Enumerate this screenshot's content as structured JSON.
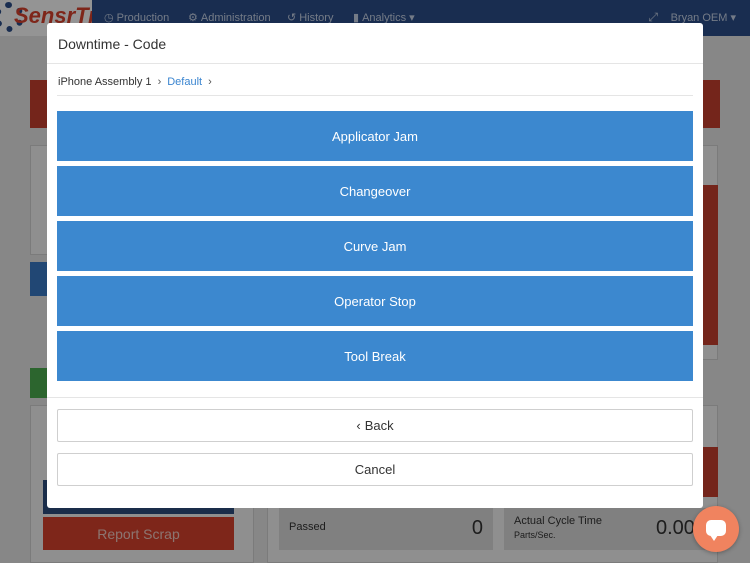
{
  "nav": {
    "logo_text": "SensrTrx",
    "items": [
      {
        "icon": "clock-icon",
        "glyph": "◷",
        "label": "Production"
      },
      {
        "icon": "gear-icon",
        "glyph": "⚙",
        "label": "Administration"
      },
      {
        "icon": "history-icon",
        "glyph": "↺",
        "label": "History"
      },
      {
        "icon": "bar-chart-icon",
        "glyph": "▮",
        "label": "Analytics ▾"
      }
    ],
    "expand_glyph": "⤢",
    "user": "Bryan OEM ▾"
  },
  "background": {
    "report_scrap": "Report Scrap",
    "passed_label": "Passed",
    "passed_value": "0",
    "cycle_label": "Actual Cycle Time",
    "cycle_unit": "Parts/Sec.",
    "cycle_value": "0.00"
  },
  "modal": {
    "title": "Downtime - Code",
    "breadcrumb": {
      "root": "iPhone Assembly 1",
      "current": "Default",
      "sep": "›"
    },
    "codes": [
      {
        "label": "Applicator Jam"
      },
      {
        "label": "Changeover"
      },
      {
        "label": "Curve Jam"
      },
      {
        "label": "Operator Stop"
      },
      {
        "label": "Tool Break"
      }
    ],
    "back_label": "Back",
    "back_glyph": "‹",
    "cancel_label": "Cancel"
  },
  "colors": {
    "code_button": "#3c88cf",
    "navbar": "#2b4f8a",
    "danger": "#d9432d",
    "chat": "#f0835f"
  }
}
